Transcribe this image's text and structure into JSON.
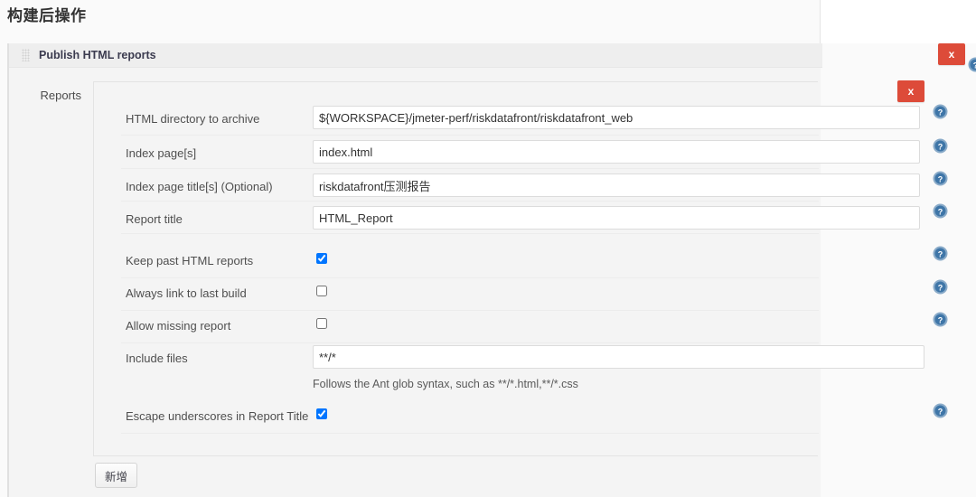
{
  "page": {
    "title": "构建后操作"
  },
  "section": {
    "title": "Publish HTML reports",
    "drag_handle_icon": "drag-handle-icon",
    "delete_label": "x"
  },
  "reports": {
    "tab_label": "Reports",
    "delete_label": "x",
    "help_icon": "help-icon",
    "rows": [
      {
        "label": "HTML directory to archive",
        "type": "text",
        "value": "${WORKSPACE}/jmeter-perf/riskdatafront/riskdatafront_web",
        "has_help": true
      },
      {
        "label": "Index page[s]",
        "type": "text",
        "value": "index.html",
        "has_help": true
      },
      {
        "label": "Index page title[s] (Optional)",
        "type": "text",
        "value": "riskdatafront压测报告",
        "has_help": true
      },
      {
        "label": "Report title",
        "type": "text",
        "value": "HTML_Report",
        "has_help": true
      },
      {
        "label": "Keep past HTML reports",
        "type": "checkbox",
        "checked": true,
        "has_help": true
      },
      {
        "label": "Always link to last build",
        "type": "checkbox",
        "checked": false,
        "has_help": true
      },
      {
        "label": "Allow missing report",
        "type": "checkbox",
        "checked": false,
        "has_help": true
      },
      {
        "label": "Include files",
        "type": "text",
        "value": "**/*",
        "has_help": false
      },
      {
        "label": "Escape underscores in Report Title",
        "type": "checkbox",
        "checked": true,
        "has_help": true
      }
    ],
    "include_files_hint": "Follows the Ant glob syntax, such as **/*.html,**/*.css"
  },
  "footer": {
    "add_button_label": "新增"
  },
  "colors": {
    "delete_red": "#dd4b39",
    "help_blue": "#3f76a8",
    "panel_bg": "#f4f4f4",
    "page_bg": "#fafafa"
  }
}
